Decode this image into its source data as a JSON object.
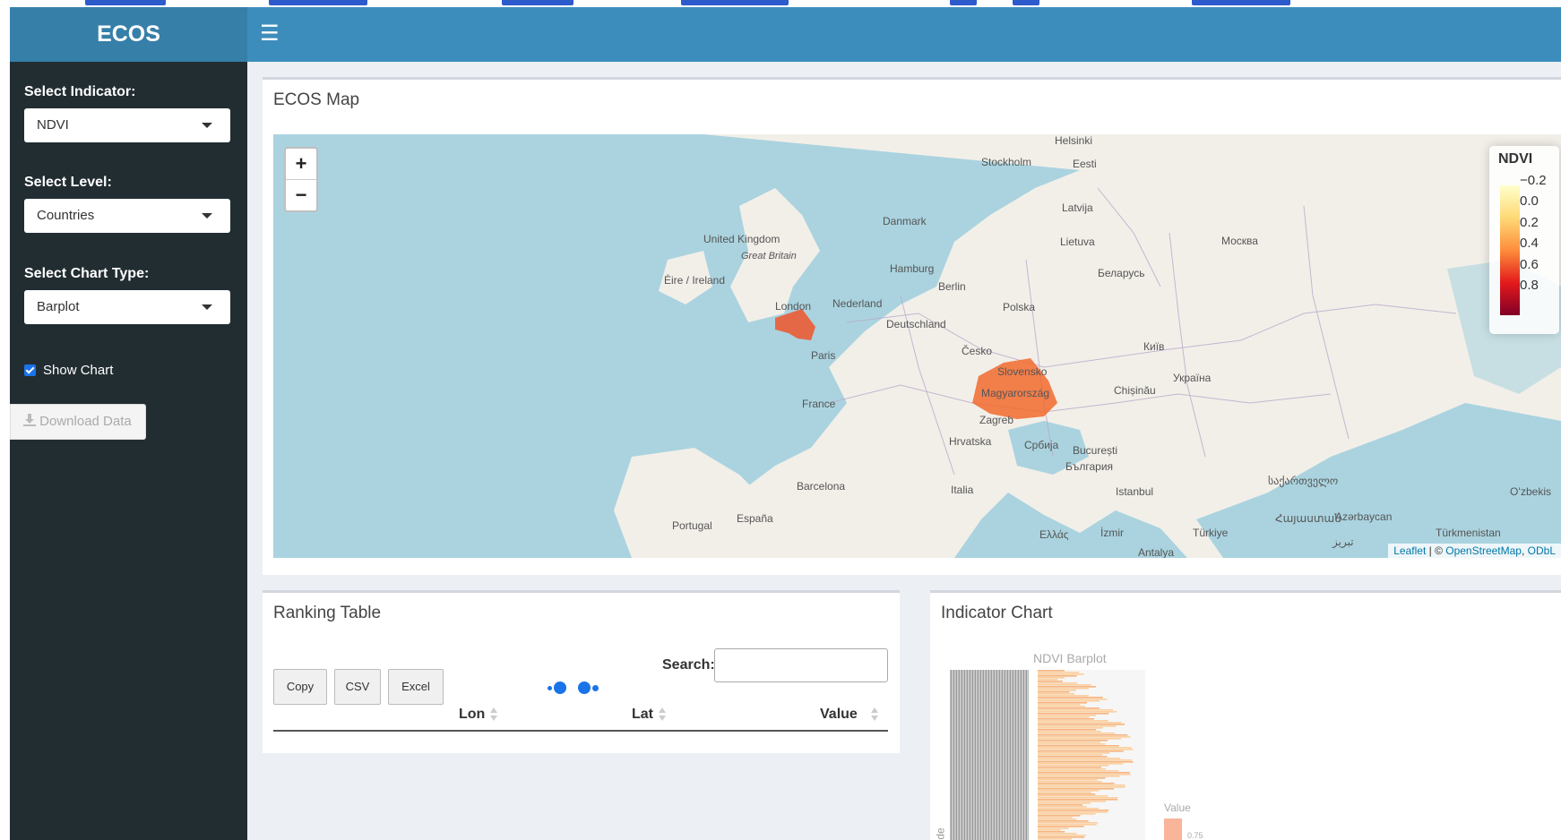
{
  "app": {
    "title": "ECOS",
    "menu_icon": "hamburger-icon"
  },
  "sidebar": {
    "indicator": {
      "label": "Select Indicator:",
      "value": "NDVI"
    },
    "level": {
      "label": "Select Level:",
      "value": "Countries"
    },
    "chart_type": {
      "label": "Select Chart Type:",
      "value": "Barplot"
    },
    "show_chart": {
      "label": "Show Chart",
      "checked": true
    },
    "download": {
      "label": "Download Data",
      "icon": "download-icon"
    }
  },
  "map_box": {
    "title": "ECOS Map",
    "zoom_in": "+",
    "zoom_out": "−",
    "legend": {
      "title": "NDVI",
      "ticks": [
        "−0.2",
        "0.0",
        "0.2",
        "0.4",
        "0.6",
        "0.8"
      ],
      "colors": [
        "#ffffcc",
        "#fed976",
        "#fd8d3c",
        "#e31a1c",
        "#800026"
      ]
    },
    "labels": [
      "Helsinki",
      "Stockholm",
      "Eesti",
      "Danmark",
      "Latvija",
      "Lietuva",
      "Москва",
      "United Kingdom",
      "Great Britain",
      "Éire / Ireland",
      "Hamburg",
      "Berlin",
      "Беларусь",
      "London",
      "Nederland",
      "Polska",
      "Deutschland",
      "Paris",
      "Česko",
      "Київ",
      "Slovensko",
      "Україна",
      "Chișinău",
      "France",
      "Magyarország",
      "Zagreb",
      "Hrvatska",
      "Србија",
      "București",
      "България",
      "Barcelona",
      "Italia",
      "Istanbul",
      "საქართველო",
      "Portugal",
      "España",
      "Ελλάς",
      "İzmir",
      "Türkiye",
      "Azərbaycan",
      "Türkmenistan",
      "Հայաստան",
      "تبریز",
      "Antalya",
      "Oʻzbekis"
    ],
    "attribution": {
      "leaflet": "Leaflet",
      "sep": " | © ",
      "osm": "OpenStreetMap",
      "odbl": "ODbL"
    }
  },
  "ranking": {
    "title": "Ranking Table",
    "buttons": [
      "Copy",
      "CSV",
      "Excel"
    ],
    "search_label": "Search:",
    "columns": [
      "Lon",
      "Lat",
      "Value"
    ]
  },
  "chart_box": {
    "title": "Indicator Chart",
    "plot_title": "NDVI Barplot",
    "legend_title": "Value",
    "legend_value": "0.75",
    "axis_fragment": "de"
  }
}
